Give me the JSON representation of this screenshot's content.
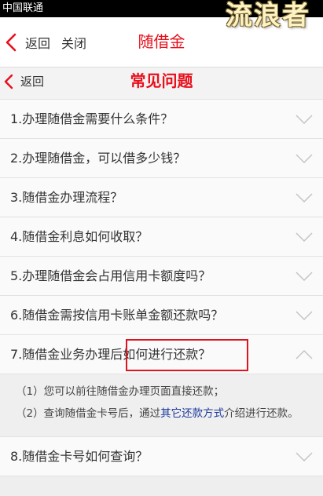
{
  "status_bar": {
    "carrier": "中国联通"
  },
  "watermark": {
    "text": "流浪者"
  },
  "top_nav": {
    "back_label": "返回",
    "close_label": "关闭",
    "title": "随借金"
  },
  "sub_nav": {
    "back_label": "返回",
    "title": "常见问题"
  },
  "faq": {
    "items": [
      {
        "question": "1.办理随借金需要什么条件？",
        "expanded": false
      },
      {
        "question": "2.办理随借金，可以借多少钱？",
        "expanded": false
      },
      {
        "question": "3.随借金办理流程？",
        "expanded": false
      },
      {
        "question": "4.随借金利息如何收取？",
        "expanded": false
      },
      {
        "question": "5.办理随借金会占用信用卡额度吗？",
        "expanded": false
      },
      {
        "question": "6.随借金需按信用卡账单金额还款吗？",
        "expanded": false
      },
      {
        "question": "7.随借金业务办理后如何进行还款？",
        "expanded": true,
        "answer": {
          "line1": "（1）您可以前往随借金办理页面直接还款；",
          "line2_prefix": "（2）查询随借金卡号后，通过",
          "line2_link": "其它还款方式",
          "line2_suffix": "介绍进行还款。"
        }
      },
      {
        "question": "8.随借金卡号如何查询？",
        "expanded": false
      }
    ]
  },
  "colors": {
    "accent_red": "#e8101c",
    "link_blue": "#1c3a9c",
    "text": "#333333",
    "chevron": "#c4c4c4",
    "highlight_box": "#e0141e"
  }
}
